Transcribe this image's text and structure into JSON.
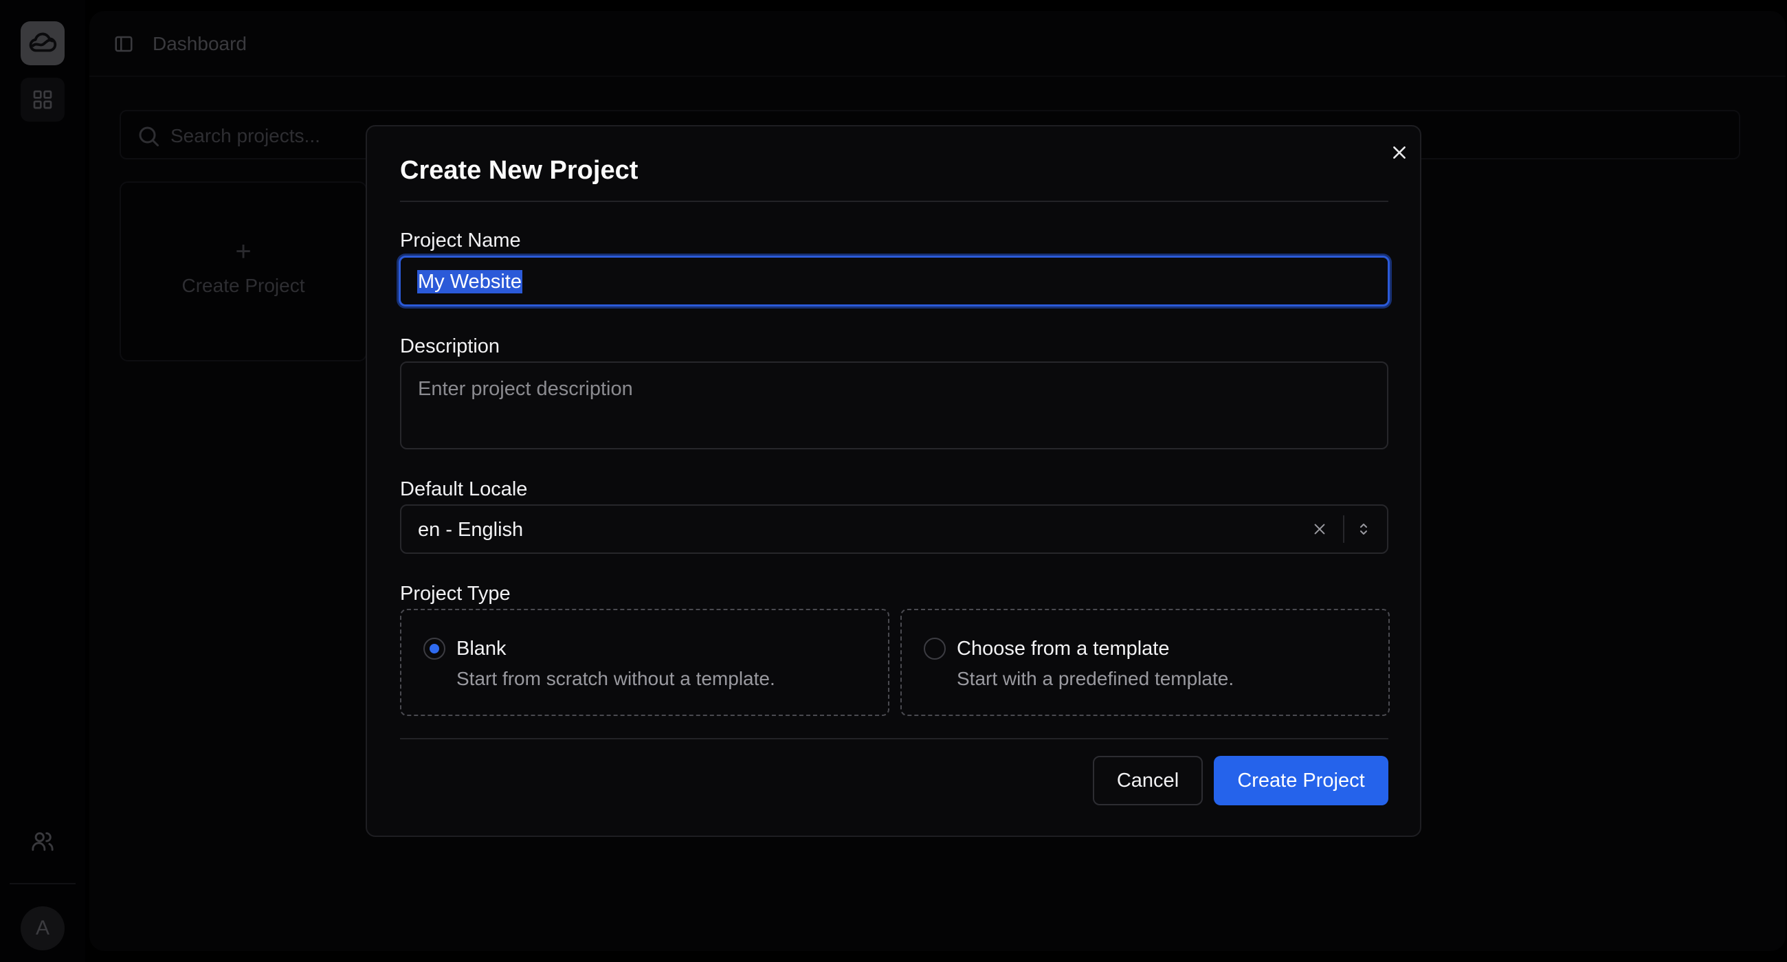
{
  "app": {
    "breadcrumb": "Dashboard",
    "avatar_initial": "A"
  },
  "sidebar": {
    "items": [
      {
        "icon": "cloud-logo-icon"
      },
      {
        "icon": "grid-icon"
      },
      {
        "icon": "users-icon"
      }
    ]
  },
  "search": {
    "placeholder": "Search projects..."
  },
  "projects": {
    "create_card_icon": "+",
    "create_card_label": "Create Project"
  },
  "modal": {
    "title": "Create New Project",
    "project_name": {
      "label": "Project Name",
      "value": "My Website"
    },
    "description": {
      "label": "Description",
      "placeholder": "Enter project description"
    },
    "locale": {
      "label": "Default Locale",
      "value": "en - English"
    },
    "project_type": {
      "label": "Project Type",
      "selected": "blank",
      "options": [
        {
          "id": "blank",
          "title": "Blank",
          "description": "Start from scratch without a template."
        },
        {
          "id": "template",
          "title": "Choose from a template",
          "description": "Start with a predefined template."
        }
      ]
    },
    "buttons": {
      "cancel": "Cancel",
      "submit": "Create Project"
    }
  },
  "colors": {
    "accent": "#2563eb",
    "background": "#000000",
    "modal_background": "#09090b"
  }
}
